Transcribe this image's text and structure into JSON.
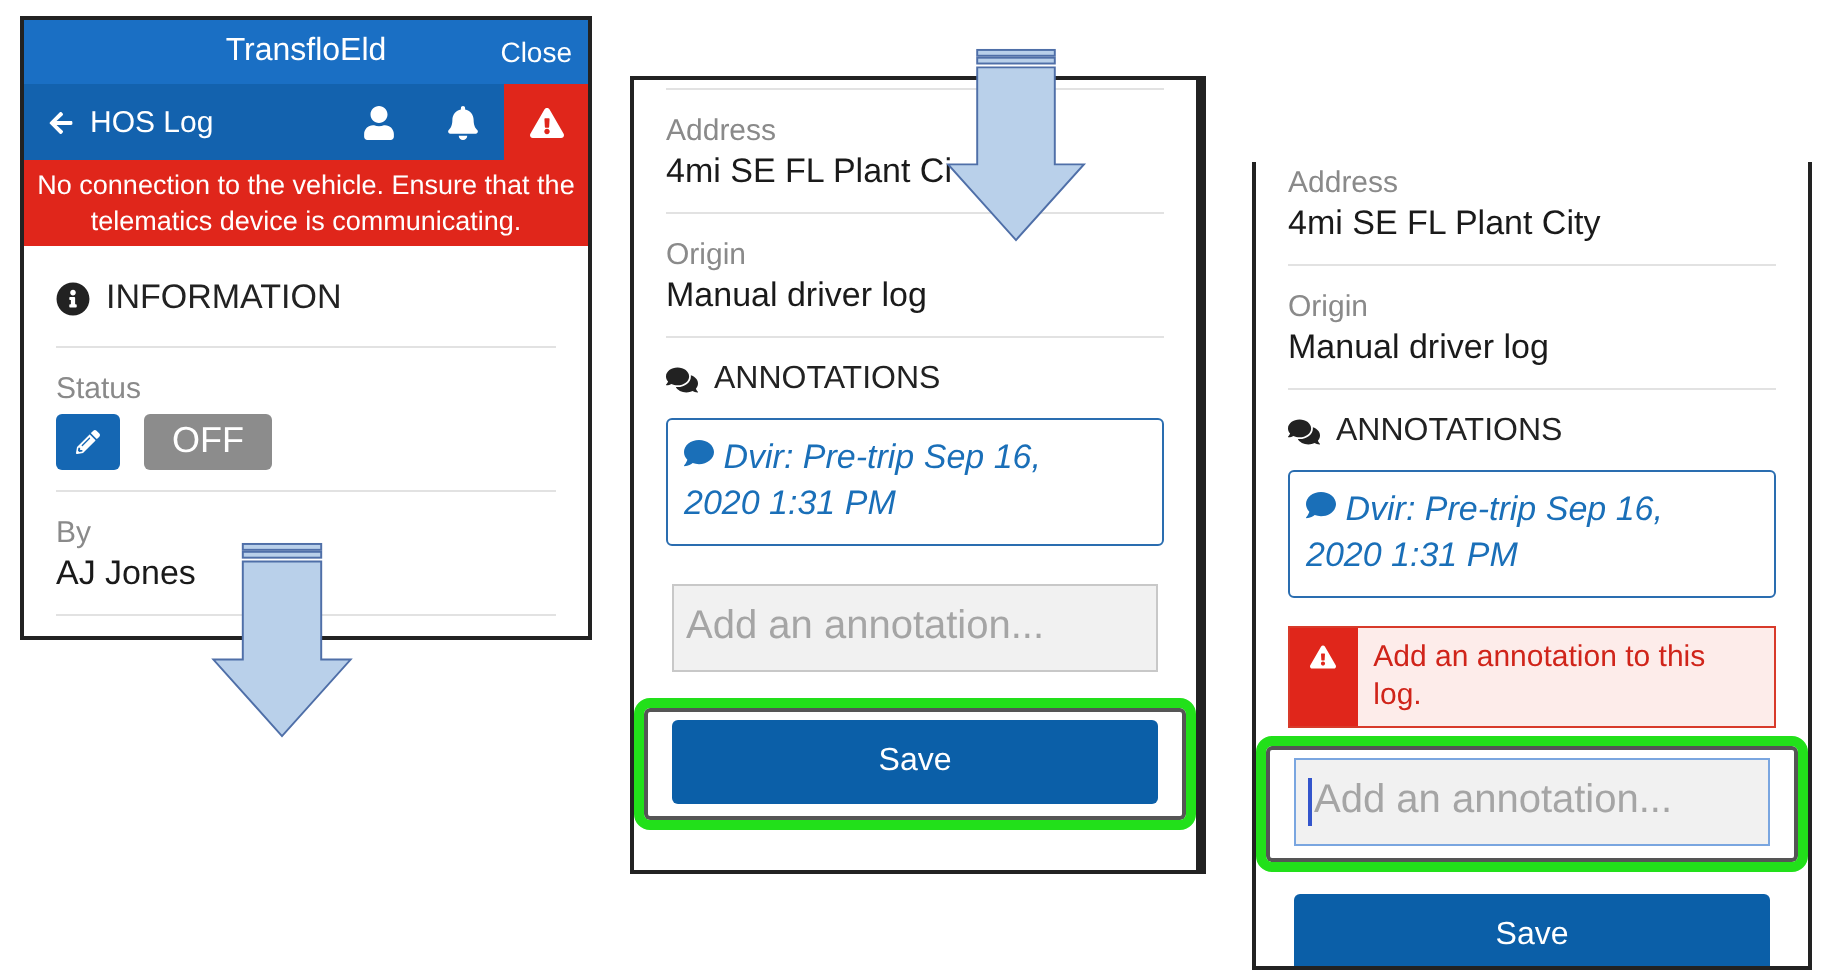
{
  "screens": [
    {
      "kind": "log",
      "header": {
        "title": "TransfloEld",
        "close": "Close"
      },
      "nav": {
        "back": "HOS Log",
        "alert": true
      },
      "banner": "No connection to the vehicle. Ensure that the telematics device is communicating.",
      "section": "INFORMATION",
      "fields": [
        {
          "kind": "status",
          "label": "Status",
          "value": "OFF"
        },
        {
          "kind": "text",
          "label": "By",
          "value": "AJ Jones"
        }
      ]
    },
    {
      "kind": "annotations",
      "top_divider": true,
      "fields": [
        {
          "label": "Address",
          "value": "4mi SE FL Plant Ci"
        },
        {
          "label": "Origin",
          "value": "Manual driver log"
        }
      ],
      "section": "ANNOTATIONS",
      "annotation": "Dvir: Pre-trip Sep 16, 2020 1:31 PM",
      "input": {
        "placeholder": "Add an annotation...",
        "focused": false,
        "highlighted": false
      },
      "save": {
        "label": "Save",
        "highlighted": true
      }
    },
    {
      "kind": "annotations",
      "top_divider": false,
      "fields": [
        {
          "label": "Address",
          "value": "4mi SE FL Plant City"
        },
        {
          "label": "Origin",
          "value": "Manual driver log"
        }
      ],
      "section": "ANNOTATIONS",
      "annotation": "Dvir: Pre-trip Sep 16, 2020 1:31 PM",
      "error": "Add an annotation to this log.",
      "input": {
        "placeholder": "Add an annotation...",
        "focused": true,
        "highlighted": true
      },
      "save": {
        "label": "Save",
        "highlighted": false
      }
    }
  ]
}
